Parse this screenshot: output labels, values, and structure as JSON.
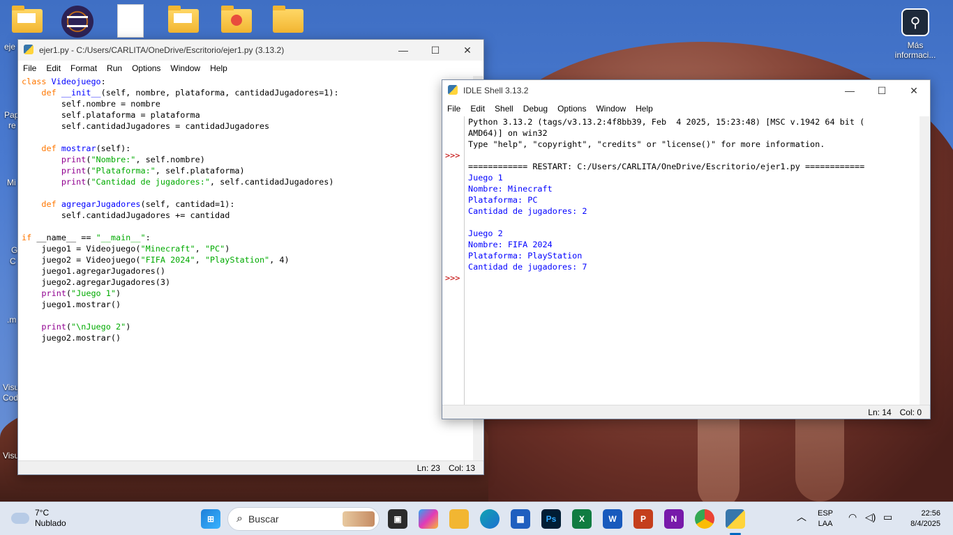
{
  "desktop": {
    "right_icon_label_1": "Más",
    "right_icon_label_2": "informaci...",
    "left_labels": [
      "eje",
      "Pap",
      "re",
      "Mi",
      "G",
      "C",
      ".m",
      "Visu",
      "Cod",
      "Visu"
    ]
  },
  "editor": {
    "title": "ejer1.py - C:/Users/CARLITA/OneDrive/Escritorio/ejer1.py (3.13.2)",
    "menu": [
      "File",
      "Edit",
      "Format",
      "Run",
      "Options",
      "Window",
      "Help"
    ],
    "status_line": "Ln: 23",
    "status_col": "Col: 13"
  },
  "shell": {
    "title": "IDLE Shell 3.13.2",
    "menu": [
      "File",
      "Edit",
      "Shell",
      "Debug",
      "Options",
      "Window",
      "Help"
    ],
    "prompt": ">>>",
    "banner_1": "Python 3.13.2 (tags/v3.13.2:4f8bb39, Feb  4 2025, 15:23:48) [MSC v.1942 64 bit (",
    "banner_2": "AMD64)] on win32",
    "banner_3": "Type \"help\", \"copyright\", \"credits\" or \"license()\" for more information.",
    "restart": "============ RESTART: C:/Users/CARLITA/OneDrive/Escritorio/ejer1.py ============",
    "output": [
      "Juego 1",
      "Nombre: Minecraft",
      "Plataforma: PC",
      "Cantidad de jugadores: 2",
      "",
      "Juego 2",
      "Nombre: FIFA 2024",
      "Plataforma: PlayStation",
      "Cantidad de jugadores: 7"
    ],
    "status_line": "Ln: 14",
    "status_col": "Col: 0"
  },
  "taskbar": {
    "temp": "7°C",
    "weather": "Nublado",
    "search_placeholder": "Buscar",
    "lang_1": "ESP",
    "lang_2": "LAA",
    "time": "22:56",
    "date": "8/4/2025"
  },
  "colors": {
    "keyword": "#ff7700",
    "defname": "#0000ff",
    "string": "#00aa00",
    "builtin": "#900090",
    "shell_output": "#0000ff",
    "prompt": "#c00000"
  }
}
